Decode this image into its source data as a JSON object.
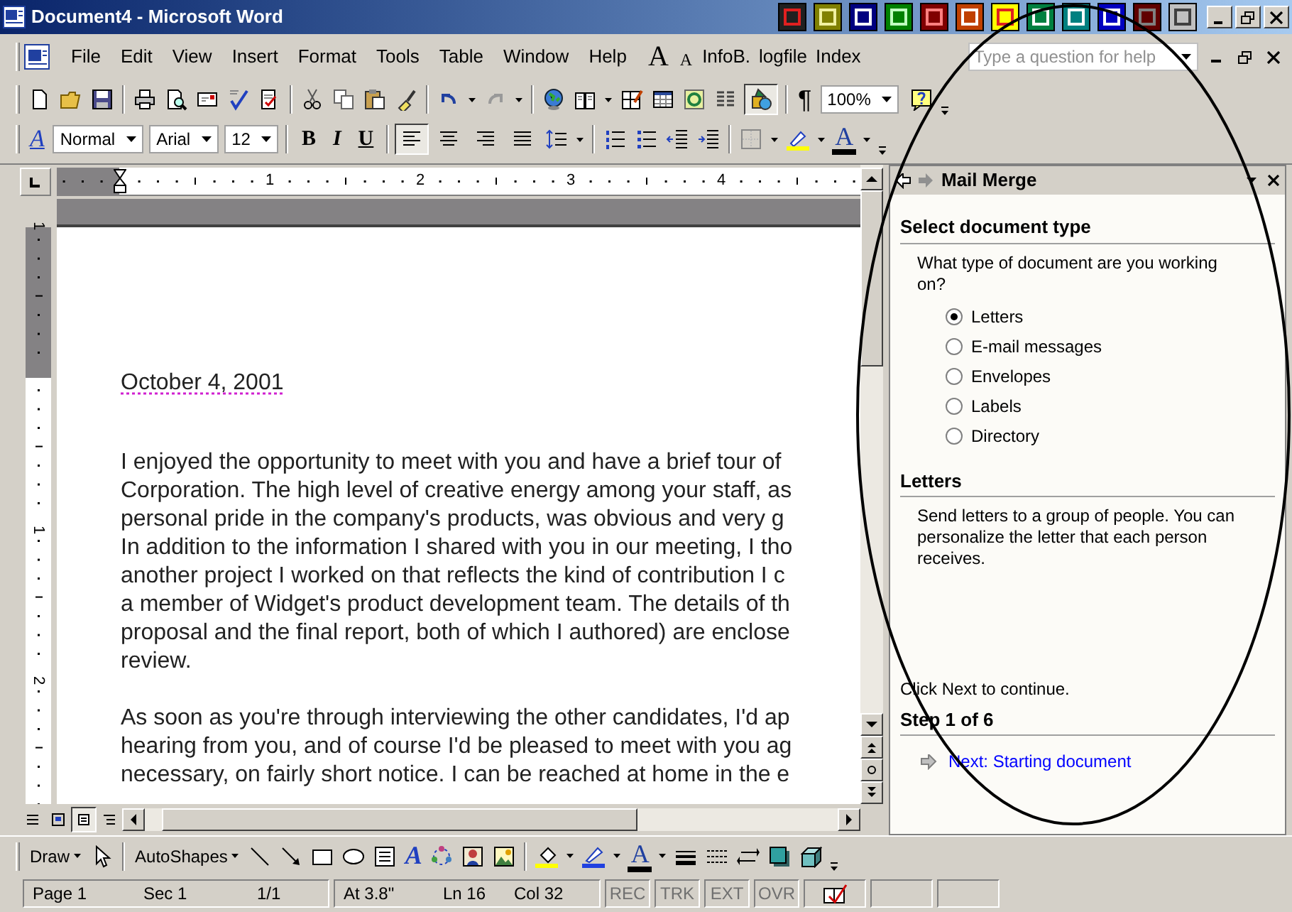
{
  "window": {
    "title": "Document4 - Microsoft Word"
  },
  "menu_bar": {
    "items": [
      {
        "label": "File"
      },
      {
        "label": "Edit"
      },
      {
        "label": "View"
      },
      {
        "label": "Insert"
      },
      {
        "label": "Format"
      },
      {
        "label": "Tools"
      },
      {
        "label": "Table"
      },
      {
        "label": "Window"
      },
      {
        "label": "Help"
      }
    ],
    "grow_font_glyph": "A",
    "shrink_font_glyph": "A",
    "extra_items": [
      "InfoB.",
      "logfile",
      "Index"
    ],
    "help_box": {
      "placeholder": "Type a question for help"
    }
  },
  "standard_toolbar": {
    "drawing_button": {
      "selected": true
    },
    "pilcrow": "¶",
    "zoom": "100%"
  },
  "formatting_toolbar": {
    "styles_glyph": "A",
    "style": "Normal",
    "font": "Arial",
    "size": "12",
    "bold": "B",
    "italic": "I",
    "underline": "U",
    "alignment": [
      {
        "selected": true
      },
      {
        "selected": false
      },
      {
        "selected": false
      },
      {
        "selected": false
      }
    ],
    "font_color_glyph": "A"
  },
  "horizontal_ruler": {
    "labels": [
      "1",
      "2",
      "3",
      "4"
    ]
  },
  "vertical_ruler": {
    "labels": [
      "1",
      "1",
      "2"
    ]
  },
  "document": {
    "date": "October 4, 2001",
    "date_flagged": true,
    "paragraphs": [
      [
        "I enjoyed the opportunity to meet with you and have a brief tour of",
        "Corporation. The high level of creative energy among your staff, as",
        "personal pride in the company's products, was obvious and very g",
        "In addition to the information I shared with you in our meeting, I tho",
        "another project I worked on that reflects the kind of contribution I c",
        "a member of Widget's product development team. The details of th",
        "proposal and the final report, both of which I authored) are enclose",
        "review."
      ],
      [
        "As soon as you're through interviewing the other candidates, I'd ap",
        "hearing from you, and of course I'd be pleased to meet with you ag",
        "necessary, on fairly short notice. I can be reached at home in the e"
      ]
    ]
  },
  "view_buttons": [
    {
      "selected": false
    },
    {
      "selected": false
    },
    {
      "selected": true
    },
    {
      "selected": false
    }
  ],
  "task_pane": {
    "title": "Mail Merge",
    "sections": [
      {
        "heading": "Select document type",
        "text": "What type of document are you working on?",
        "options": [
          {
            "label": "Letters",
            "selected": true
          },
          {
            "label": "E-mail messages",
            "selected": false
          },
          {
            "label": "Envelopes",
            "selected": false
          },
          {
            "label": "Labels",
            "selected": false
          },
          {
            "label": "Directory",
            "selected": false
          }
        ]
      },
      {
        "heading": "Letters",
        "text": "Send letters to a group of people. You can personalize the letter that each person receives."
      }
    ],
    "footer_text": "Click Next to continue.",
    "step": "Step 1 of 6",
    "next_link": "Next: Starting document"
  },
  "drawing_toolbar": {
    "draw": "Draw",
    "autoshapes": "AutoShapes",
    "wordart_glyph": "A",
    "font_color_glyph": "A"
  },
  "status_bar": {
    "fields": [
      "Page 1",
      "Sec 1",
      "1/1",
      "At 3.8\"",
      "Ln 16",
      "Col 32"
    ],
    "modes": [
      {
        "label": "REC",
        "on": false
      },
      {
        "label": "TRK",
        "on": false
      },
      {
        "label": "EXT",
        "on": false
      },
      {
        "label": "OVR",
        "on": false
      }
    ]
  }
}
